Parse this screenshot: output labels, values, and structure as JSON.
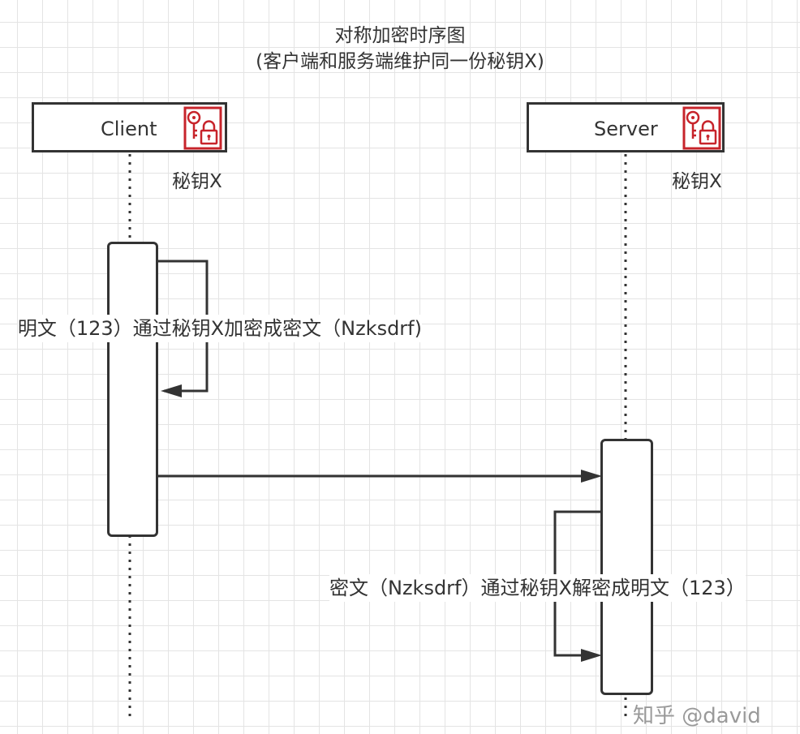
{
  "diagram": {
    "title_line1": "对称加密时序图",
    "title_line2": "(客户端和服务端维护同一份秘钥X)",
    "participants": [
      {
        "name": "Client",
        "key_label": "秘钥X",
        "icon": "key-lock-icon"
      },
      {
        "name": "Server",
        "key_label": "秘钥X",
        "icon": "key-lock-icon"
      }
    ],
    "messages": [
      {
        "label": "明文（123）通过秘钥X加密成密文（Nzksdrf)",
        "type": "self",
        "from": "Client"
      },
      {
        "label": "",
        "type": "sync",
        "from": "Client",
        "to": "Server"
      },
      {
        "label": "密文（Nzksdrf）通过秘钥X解密成明文（123）",
        "type": "self",
        "from": "Server"
      }
    ],
    "colors": {
      "line": "#333333",
      "icon": "#c7242b",
      "grid": "#e4e4e4"
    }
  },
  "watermark": "知乎 @david"
}
